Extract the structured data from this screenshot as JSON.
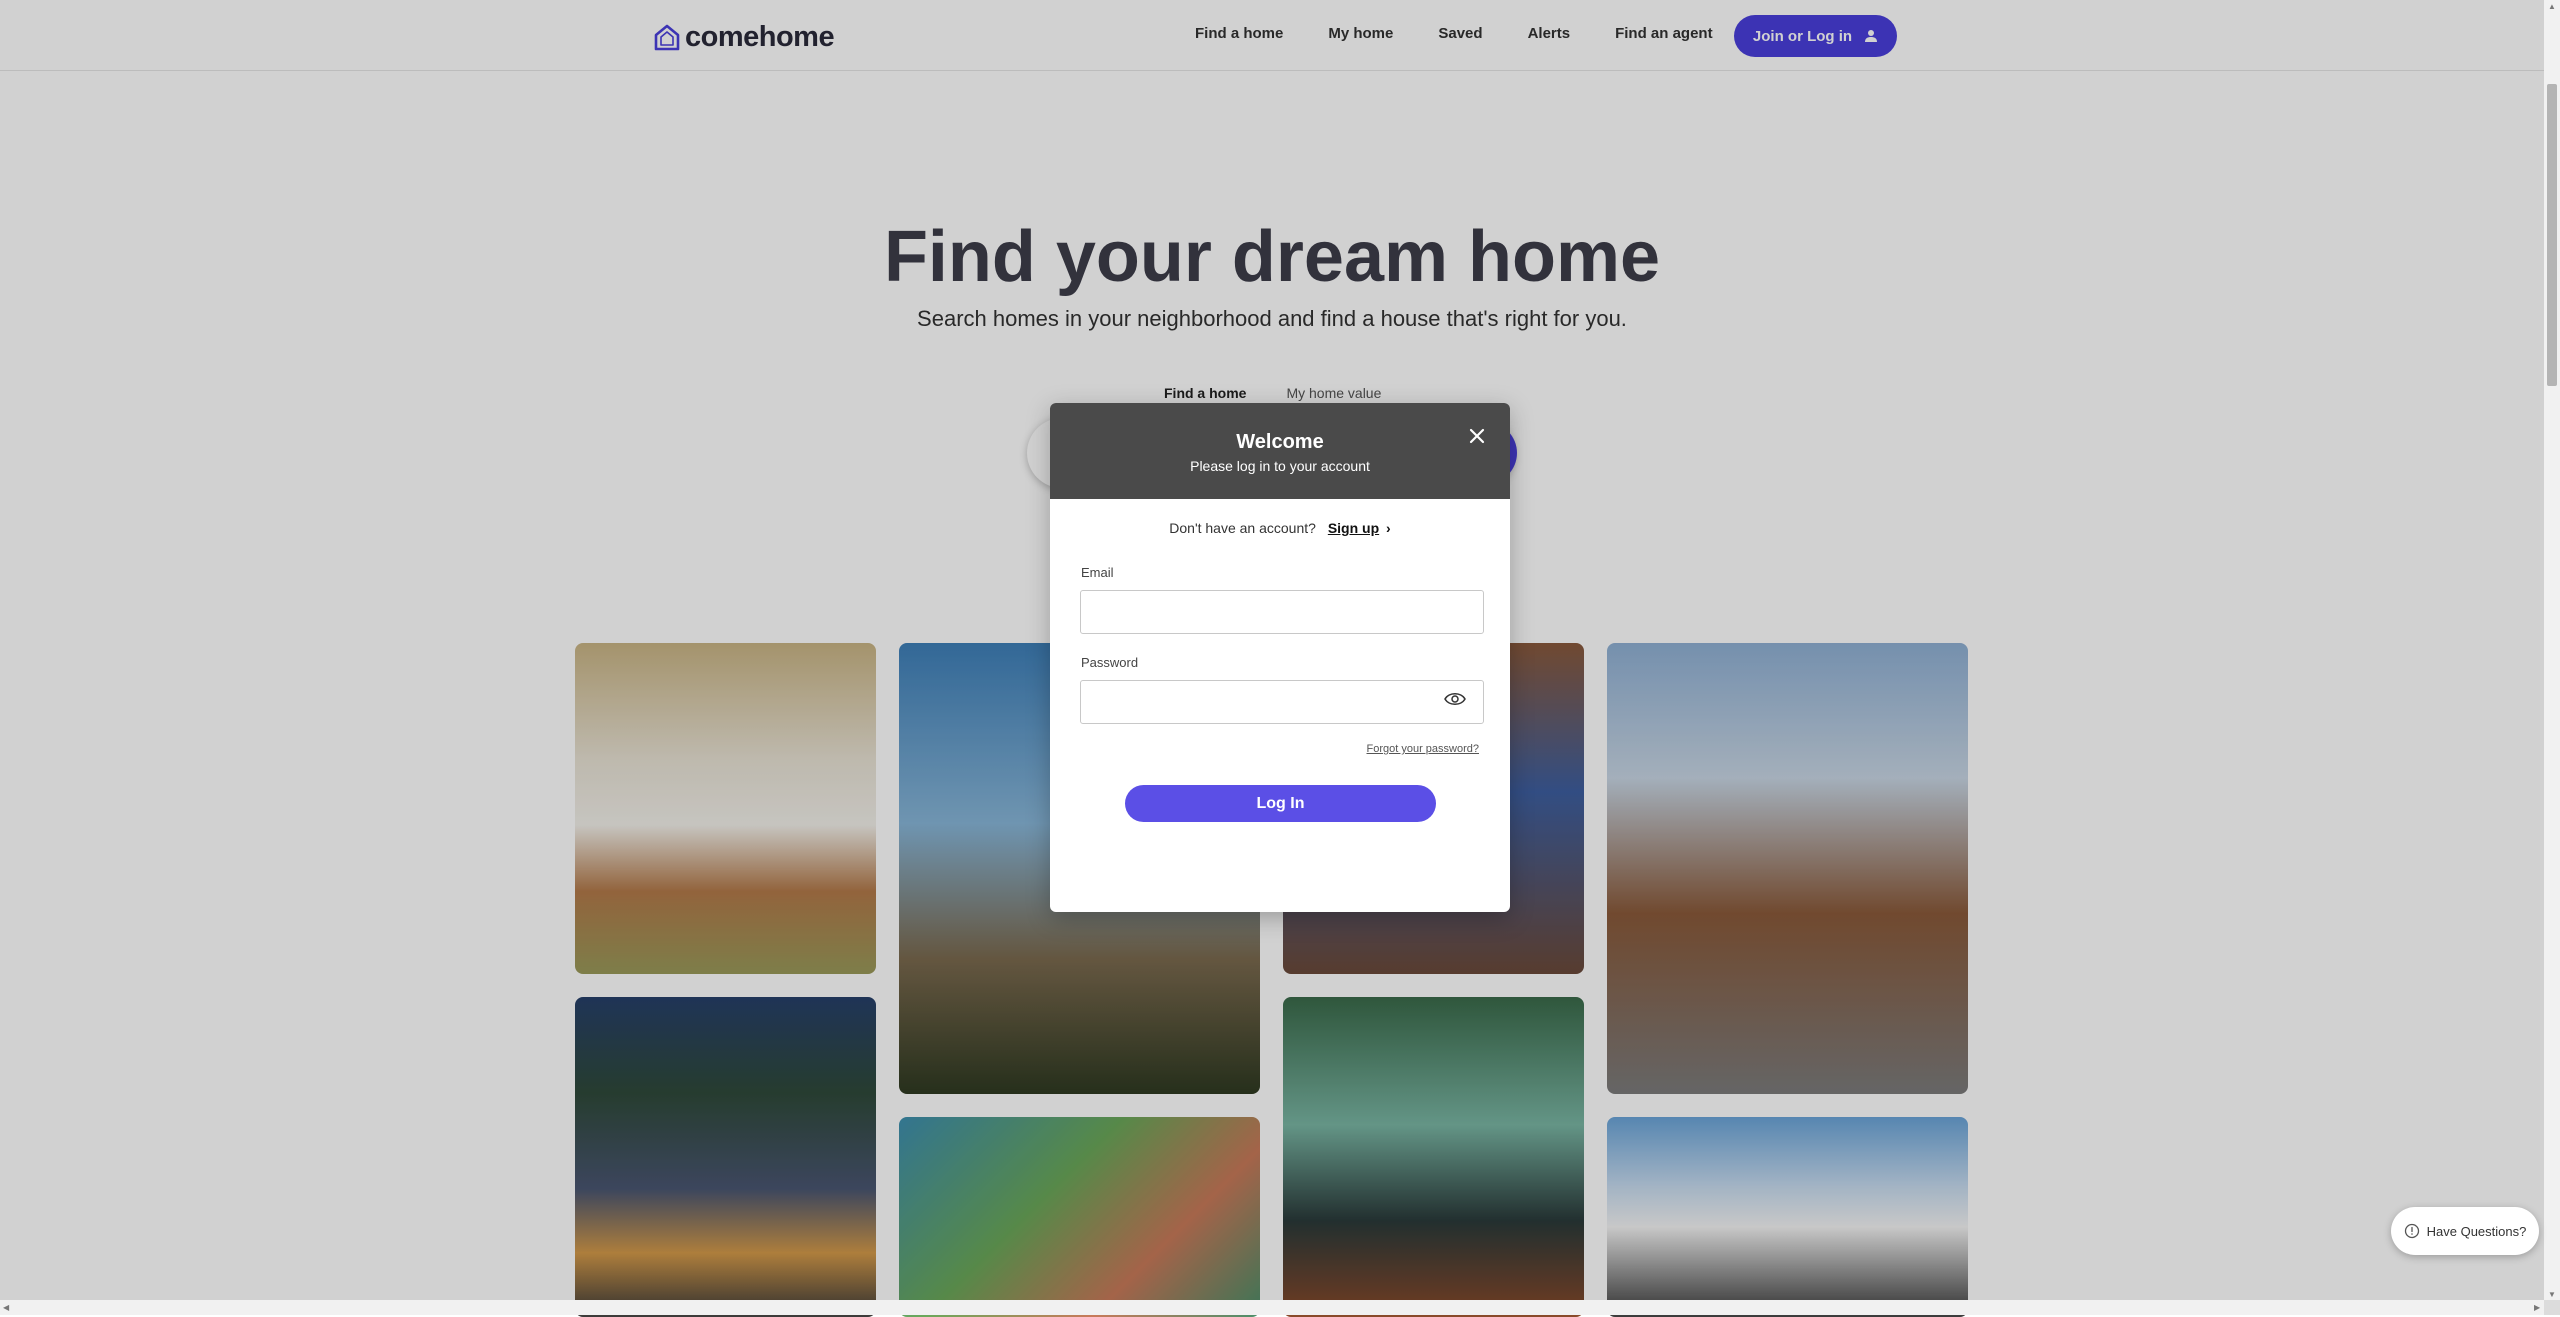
{
  "header": {
    "logo_text": "comehome",
    "nav": [
      "Find a home",
      "My home",
      "Saved",
      "Alerts",
      "Find an agent"
    ],
    "join_label": "Join or Log in"
  },
  "hero": {
    "title": "Find your dream home",
    "subtitle": "Search homes in your neighborhood and find a house that's right for you.",
    "tabs": [
      "Find a home",
      "My home value"
    ]
  },
  "modal": {
    "title": "Welcome",
    "subtitle": "Please log in to your account",
    "signup_prompt": "Don't have an account?",
    "signup_link": "Sign up",
    "email_label": "Email",
    "email_value": "",
    "password_label": "Password",
    "password_value": "",
    "forgot_link": "Forgot your password?",
    "login_button": "Log In"
  },
  "help": {
    "label": "Have Questions?"
  },
  "colors": {
    "brand": "#4a3fdc",
    "modal_header": "#4a4a4a",
    "login_button": "#5b4fe6"
  },
  "icons": {
    "logo": "house-outline-icon",
    "user": "user-icon",
    "close": "close-icon",
    "show_password": "eye-icon",
    "chat": "chat-bubble-icon",
    "chevron": "chevron-right-icon"
  }
}
